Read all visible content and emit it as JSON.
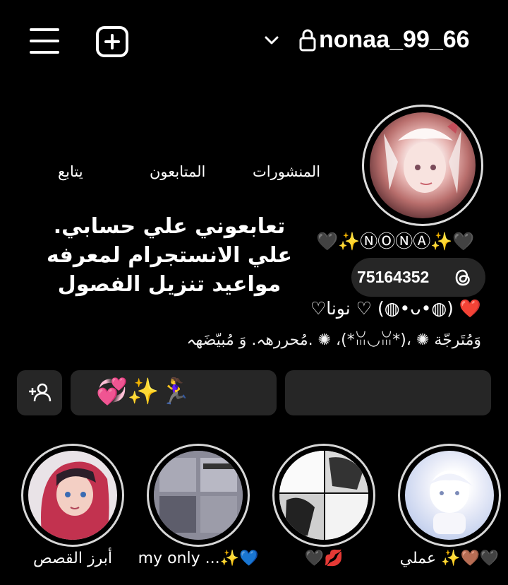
{
  "header": {
    "username": "nonaa_99_66"
  },
  "stats": {
    "posts_label": "المنشورات",
    "followers_label": "المتابعون",
    "following_label": "يتابع"
  },
  "overlay_text": "تعابعوني علي حسابي. علي الانستجرام لمعرفه مواعيد تنزيل الفصول",
  "profile": {
    "display_name": "🖤✨ⓃⓄⓃⒶ✨🖤",
    "threads_count": "75164352",
    "bio_line1": "♡نونا ♡ (◍•ᴗ•◍) ❤️",
    "bio_line2": "مُحررهہ. وَ مُبيّضَهہ. ✺ ،(*ꈍ◡ꈍ*)، ✺ وَمُتَرجّة"
  },
  "actions": {
    "emoji_button_label": "💞✨🏃‍♀️"
  },
  "highlights": [
    {
      "label": "عملي ✨🤎🖤",
      "theme": "#dfe6f5"
    },
    {
      "label": "🖤💋",
      "theme": "#cfcfcf"
    },
    {
      "label": "my only ...✨💙",
      "theme": "#8f8fa0"
    },
    {
      "label": "أبرز القصص",
      "theme": "#c24a5e"
    }
  ]
}
